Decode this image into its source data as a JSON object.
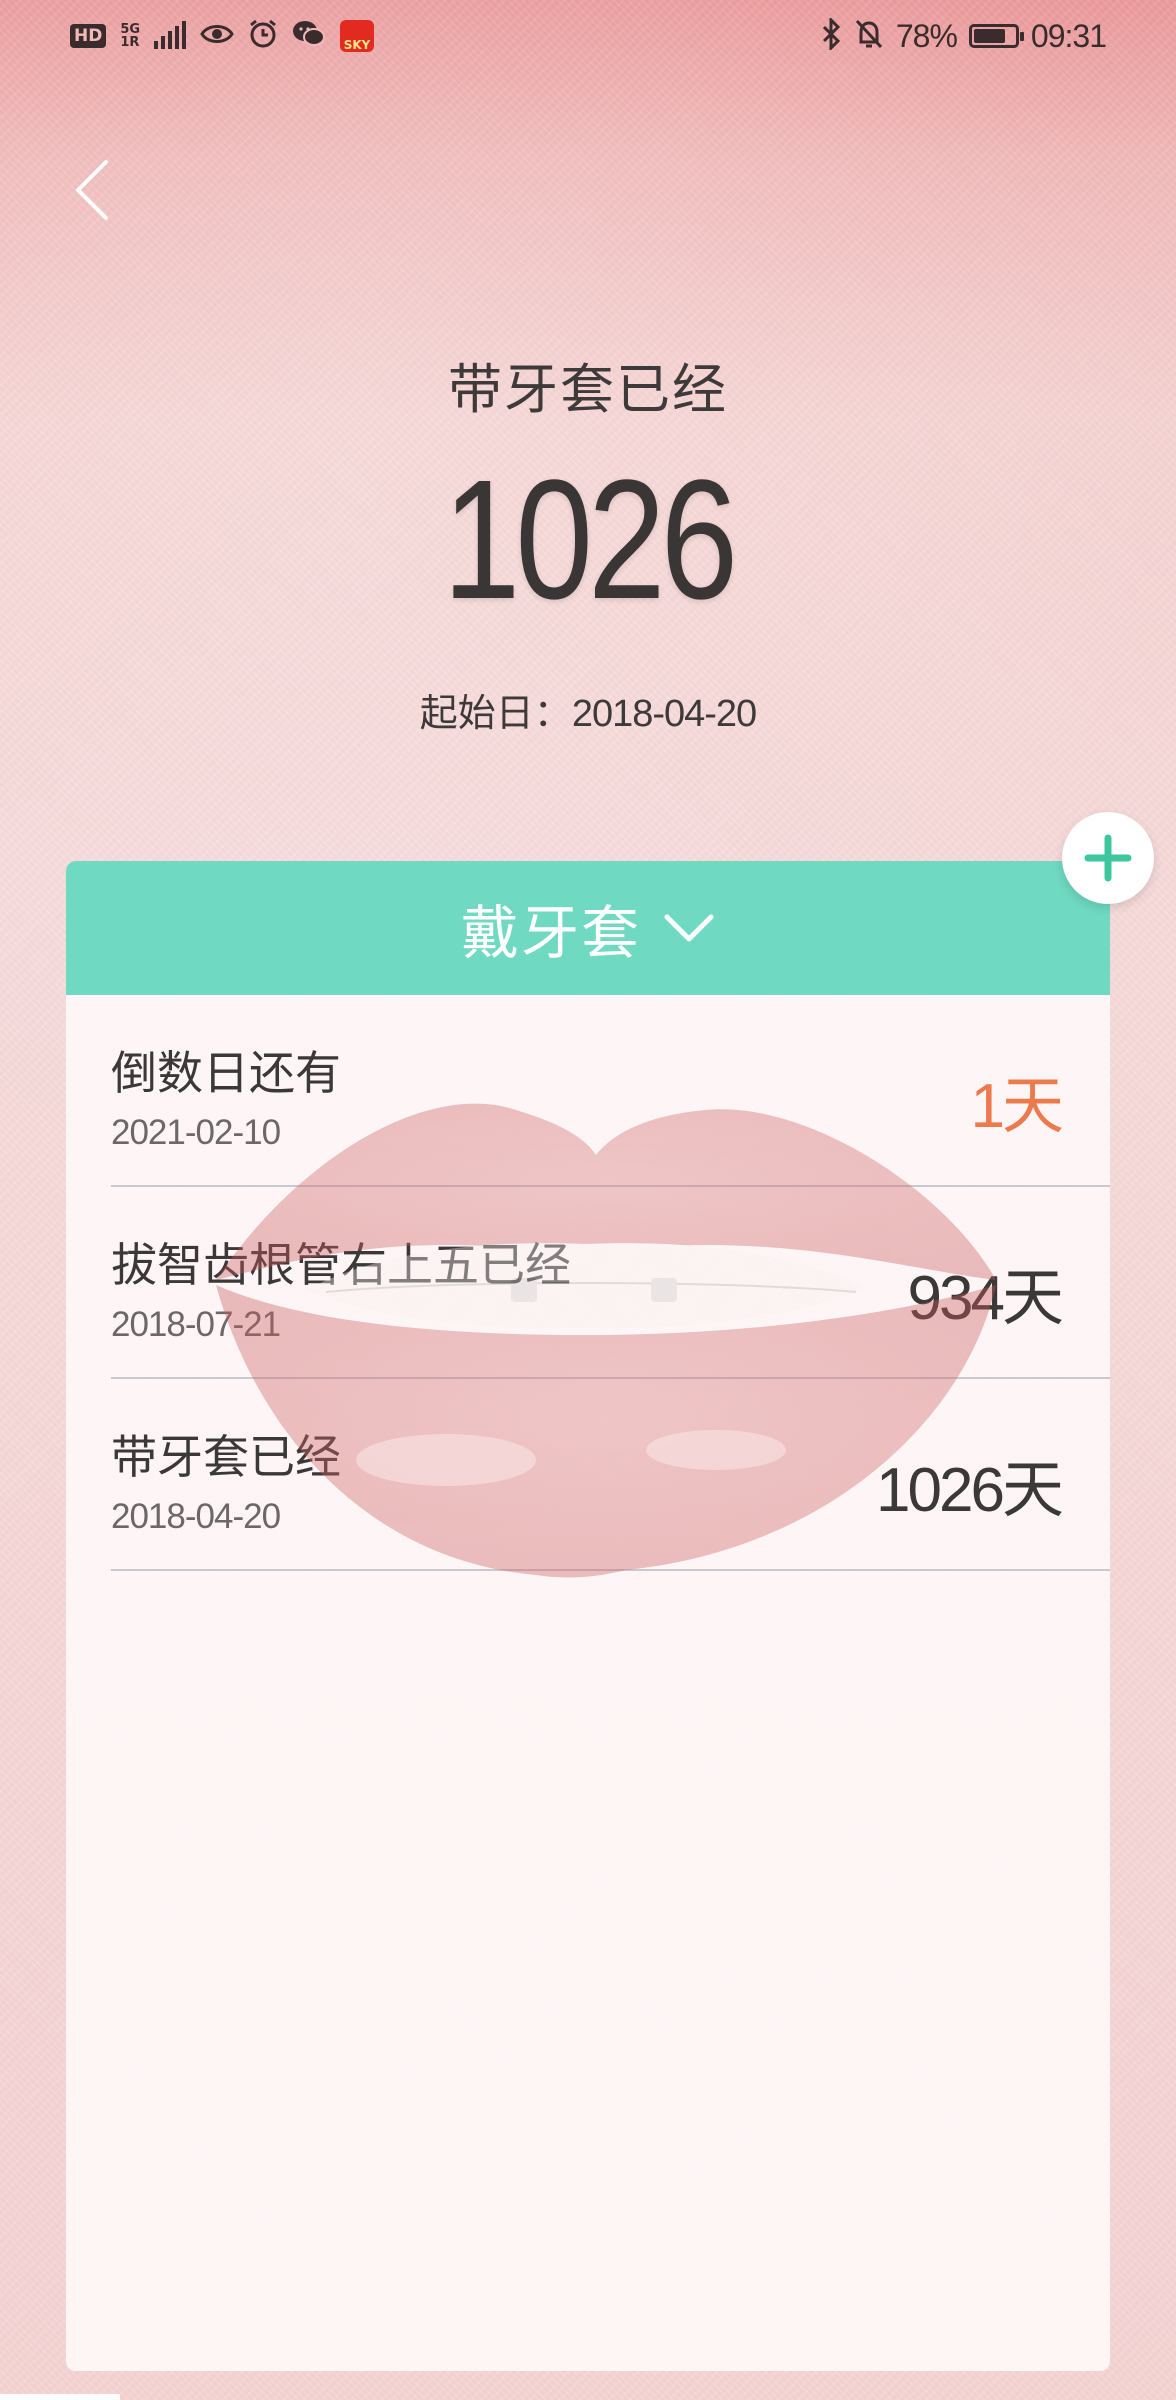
{
  "status_bar": {
    "hd": "HD",
    "network": "5G",
    "network_sub": "1R",
    "app_icon_text": "SKY",
    "battery_pct": "78%",
    "battery_level": 0.78,
    "time": "09:31"
  },
  "header": {
    "title": "带牙套已经",
    "count": "1026",
    "start_label": "起始日：",
    "start_date": "2018-04-20"
  },
  "category": {
    "label": "戴牙套"
  },
  "events": [
    {
      "title": "倒数日还有",
      "date": "2021-02-10",
      "days": "1",
      "unit": "天",
      "highlight": true
    },
    {
      "title": "拔智齿根管右上五已经",
      "date": "2018-07-21",
      "days": "934",
      "unit": "天",
      "highlight": false
    },
    {
      "title": "带牙套已经",
      "date": "2018-04-20",
      "days": "1026",
      "unit": "天",
      "highlight": false
    }
  ],
  "colors": {
    "accent": "#6fd9c1",
    "highlight": "#ec7a4d",
    "text": "#3b3838"
  }
}
